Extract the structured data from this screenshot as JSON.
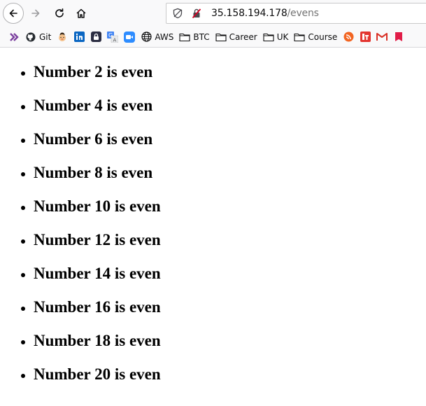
{
  "browser": {
    "address_bar": {
      "host": "35.158.194.178",
      "path": "/evens"
    },
    "icons": {
      "back": "back-arrow-icon",
      "forward": "forward-arrow-icon",
      "reload": "reload-icon",
      "home": "home-icon",
      "tracking": "tracking-protection-icon",
      "insecure": "insecure-connection-icon"
    }
  },
  "bookmarks": [
    {
      "label": "",
      "icon": "extension-icon"
    },
    {
      "label": "Git",
      "icon": "github-icon"
    },
    {
      "label": "",
      "icon": "avatar-icon"
    },
    {
      "label": "",
      "icon": "linkedin-icon"
    },
    {
      "label": "",
      "icon": "lock-app-icon"
    },
    {
      "label": "",
      "icon": "translate-icon"
    },
    {
      "label": "",
      "icon": "zoom-icon"
    },
    {
      "label": "AWS",
      "icon": "globe-icon"
    },
    {
      "label": "BTC",
      "icon": "folder-icon"
    },
    {
      "label": "Career",
      "icon": "folder-icon"
    },
    {
      "label": "UK",
      "icon": "folder-icon"
    },
    {
      "label": "Course",
      "icon": "folder-icon"
    },
    {
      "label": "",
      "icon": "rss-icon"
    },
    {
      "label": "",
      "icon": "app-red-icon"
    },
    {
      "label": "",
      "icon": "gmail-icon"
    },
    {
      "label": "",
      "icon": "bookmark-red-icon"
    }
  ],
  "page": {
    "items": [
      "Number 2 is even",
      "Number 4 is even",
      "Number 6 is even",
      "Number 8 is even",
      "Number 10 is even",
      "Number 12 is even",
      "Number 14 is even",
      "Number 16 is even",
      "Number 18 is even",
      "Number 20 is even"
    ]
  }
}
